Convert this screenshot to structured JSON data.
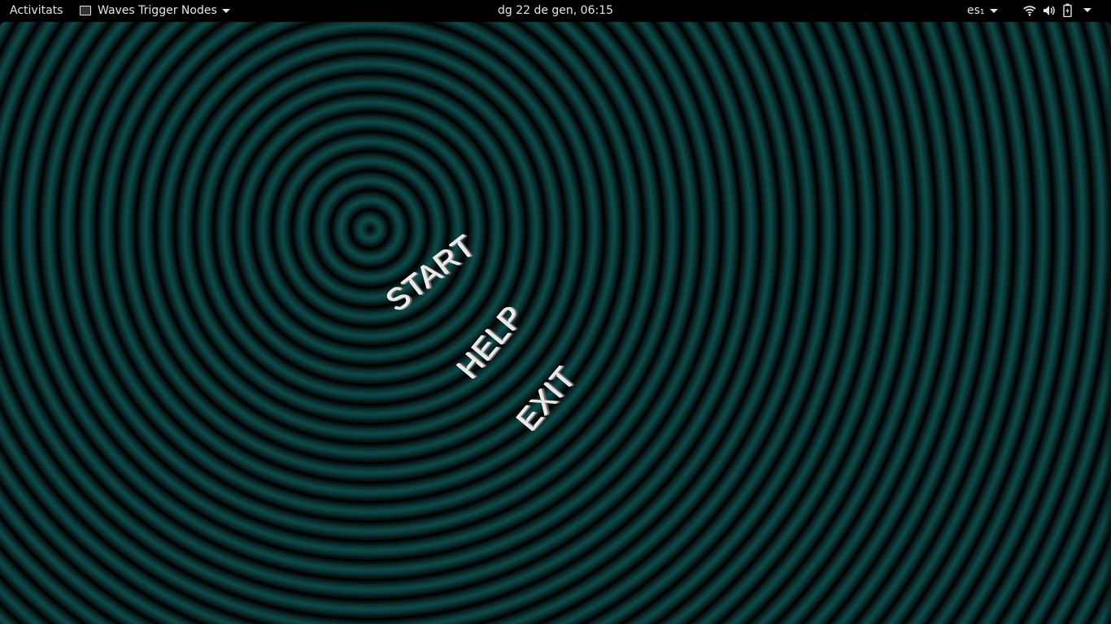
{
  "topbar": {
    "activities_label": "Activitats",
    "app_name": "Waves Trigger Nodes",
    "clock": "dg 22 de gen, 06:15",
    "keyboard_layout": "es₁",
    "icons": [
      "wifi-icon",
      "volume-icon",
      "battery-icon"
    ]
  },
  "game": {
    "menu": {
      "start": "START",
      "help": "HELP",
      "exit": "EXIT"
    },
    "colors": {
      "ring_dark": "#000000",
      "ring_light": "#0b4b4a",
      "menu_text": "#e8e8e8"
    }
  }
}
